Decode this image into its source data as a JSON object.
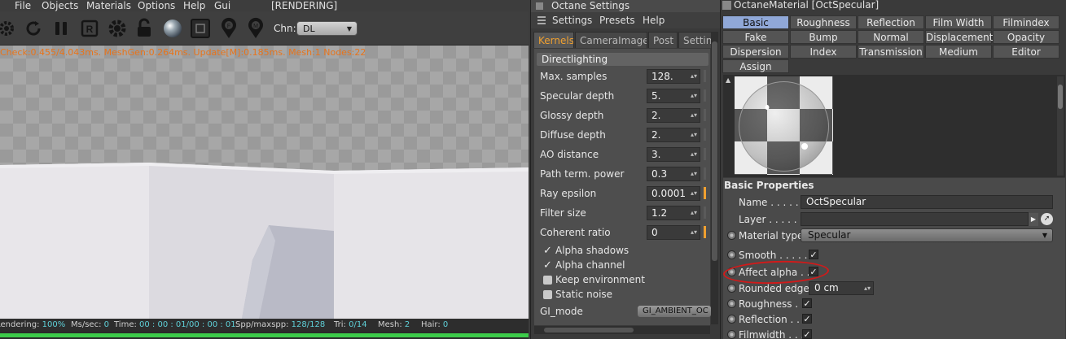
{
  "viewer": {
    "menu": [
      "File",
      "Objects",
      "Materials",
      "Options",
      "Help",
      "Gui"
    ],
    "status_label": "[RENDERING]",
    "toolbar_icons": [
      "gear-icon",
      "refresh-icon",
      "pause-icon",
      "region-render-icon",
      "settings-gear-icon",
      "lock-icon",
      "material-ball-icon",
      "frame-icon",
      "focus-pick-icon",
      "material-pick-icon"
    ],
    "channel_label": "Chn:",
    "channel_value": "DL",
    "stats_line": "Check:0.455/4.043ms. MeshGen:0.264ms. Update[M]:0.185ms. Mesh:1 Nodes:22",
    "status": {
      "rendering_label": "Rendering:",
      "rendering_value": "100%",
      "ms_label": "Ms/sec:",
      "ms_value": "0",
      "time_label": "Time:",
      "time_value": "00 : 00 : 01/00 : 00 : 01",
      "spp_label": "Spp/maxspp:",
      "spp_value": "128/128",
      "tri_label": "Tri:",
      "tri_value": "0/14",
      "mesh_label": "Mesh:",
      "mesh_value": "2",
      "hair_label": "Hair:",
      "hair_value": "0"
    },
    "progress": 1.0
  },
  "settings": {
    "title": "Octane Settings",
    "menu": [
      "Settings",
      "Presets",
      "Help"
    ],
    "tabs": [
      "Kernels",
      "CameraImager",
      "Post",
      "Settings"
    ],
    "active_tab": "Kernels",
    "section": "Directlighting",
    "fields": [
      {
        "label": "Max. samples",
        "value": "128.",
        "bar_on": false
      },
      {
        "label": "Specular depth",
        "value": "5.",
        "bar_on": false
      },
      {
        "label": "Glossy depth",
        "value": "2.",
        "bar_on": false
      },
      {
        "label": "Diffuse depth",
        "value": "2.",
        "bar_on": false
      },
      {
        "label": "AO distance",
        "value": "3.",
        "bar_on": false
      },
      {
        "label": "Path term. power",
        "value": "0.3",
        "bar_on": false
      },
      {
        "label": "Ray epsilon",
        "value": "0.0001",
        "bar_on": true
      },
      {
        "label": "Filter size",
        "value": "1.2",
        "bar_on": false
      },
      {
        "label": "Coherent ratio",
        "value": "0",
        "bar_on": true
      }
    ],
    "checkboxes": [
      {
        "label": "Alpha shadows",
        "checked": true
      },
      {
        "label": "Alpha channel",
        "checked": true
      },
      {
        "label": "Keep environment",
        "checked": false
      },
      {
        "label": "Static noise",
        "checked": false
      }
    ],
    "gi_mode_label": "GI_mode",
    "gi_mode_value": "GI_AMBIENT_OC"
  },
  "material": {
    "title": "OctaneMaterial [OctSpecular]",
    "tabs": [
      [
        "Basic",
        "Roughness",
        "Reflection",
        "Film Width",
        "Filmindex"
      ],
      [
        "Fake shadows",
        "Bump",
        "Normal",
        "Displacement",
        "Opacity"
      ],
      [
        "Dispersion",
        "Index",
        "Transmission",
        "Medium",
        "Editor"
      ],
      [
        "Assign"
      ]
    ],
    "active_tab": "Basic",
    "section": "Basic Properties",
    "name_label": "Name . . . . . .",
    "name_value": "OctSpecular",
    "layer_label": "Layer . . . . . .",
    "layer_value": "",
    "material_type_label": "Material type",
    "material_type_value": "Specular",
    "toggles": [
      {
        "label": "Smooth . . . . . .",
        "checked": true,
        "highlighted": false
      },
      {
        "label": "Affect alpha . . .",
        "checked": true,
        "highlighted": true
      },
      {
        "label": "Roughness . . .",
        "checked": true,
        "highlighted": false
      },
      {
        "label": "Reflection . . . .",
        "checked": true,
        "highlighted": false
      },
      {
        "label": "Filmwidth . . . .",
        "checked": true,
        "highlighted": false
      }
    ],
    "rounded_edges_label": "Rounded edges",
    "rounded_edges_value": "0 cm",
    "colors": {
      "active_tab": "#90a8d8",
      "highlight_circle": "#d11a1a",
      "accent": "#f0a030",
      "progress": "#3ccc4a"
    }
  }
}
